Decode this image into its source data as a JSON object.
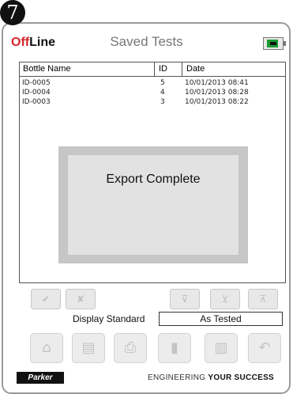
{
  "step_number": "7",
  "header": {
    "logo_accent": "Off",
    "logo_rest": "Line",
    "title": "Saved Tests",
    "battery_icon": "battery-plugged-icon"
  },
  "table": {
    "columns": [
      "Bottle Name",
      "ID",
      "Date"
    ],
    "rows": [
      [
        "ID-0005",
        "5",
        "10/01/2013 08:41"
      ],
      [
        "ID-0004",
        "4",
        "10/01/2013 08:28"
      ],
      [
        "ID-0003",
        "3",
        "10/01/2013 08:22"
      ]
    ]
  },
  "dialog": {
    "message": "Export Complete"
  },
  "small_buttons": [
    {
      "name": "check-all-button",
      "icon": "checkmark-icon",
      "glyph": "✔"
    },
    {
      "name": "uncheck-all-button",
      "icon": "uncheck-icon",
      "glyph": "✘"
    },
    {
      "name": "filter-button",
      "icon": "filter-icon",
      "glyph": "⊽"
    },
    {
      "name": "filter-edit-button",
      "icon": "filter-edit-icon",
      "glyph": "⊻"
    },
    {
      "name": "filter-clear-button",
      "icon": "filter-clear-icon",
      "glyph": "⊼"
    }
  ],
  "display": {
    "label": "Display Standard",
    "value": "As Tested"
  },
  "toolbar": [
    {
      "name": "home-button",
      "icon": "home-icon",
      "glyph": "⌂"
    },
    {
      "name": "report-button",
      "icon": "document-icon",
      "glyph": "▤"
    },
    {
      "name": "print-button",
      "icon": "printer-icon",
      "glyph": "⎙"
    },
    {
      "name": "export-button",
      "icon": "usb-export-icon",
      "glyph": "▮"
    },
    {
      "name": "delete-button",
      "icon": "trash-icon",
      "glyph": "▥"
    },
    {
      "name": "back-button",
      "icon": "back-arrow-icon",
      "glyph": "↶"
    }
  ],
  "footer": {
    "brand": "Parker",
    "tagline_plain": "ENGINEERING ",
    "tagline_bold": "YOUR SUCCESS"
  }
}
